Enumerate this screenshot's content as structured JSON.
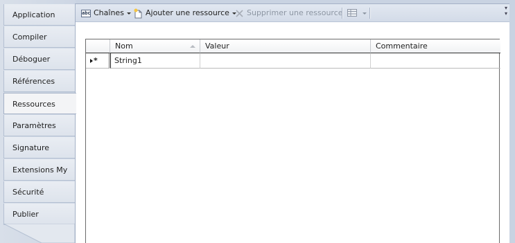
{
  "sidebar": {
    "items": [
      {
        "label": "Application"
      },
      {
        "label": "Compiler"
      },
      {
        "label": "Déboguer"
      },
      {
        "label": "Références"
      },
      {
        "label": "Ressources"
      },
      {
        "label": "Paramètres"
      },
      {
        "label": "Signature"
      },
      {
        "label": "Extensions My"
      },
      {
        "label": "Sécurité"
      },
      {
        "label": "Publier"
      }
    ],
    "active": "Ressources"
  },
  "toolbar": {
    "strings_label": "Chaînes",
    "strings_icon": "abc-icon",
    "add_label": "Ajouter une ressource",
    "add_icon": "new-document-icon",
    "remove_label": "Supprimer une ressource",
    "remove_icon": "delete-x-icon",
    "view_icon": "grid-view-icon"
  },
  "grid": {
    "columns": [
      "Nom",
      "Valeur",
      "Commentaire"
    ],
    "rows": [
      {
        "name": "String1",
        "value": "",
        "comment": ""
      }
    ],
    "new_row_marker_icon": "new-row-star-icon"
  },
  "colors": {
    "background": "#c9d3e2",
    "panel": "#ffffff",
    "toolbar": "#d9e0ec"
  }
}
